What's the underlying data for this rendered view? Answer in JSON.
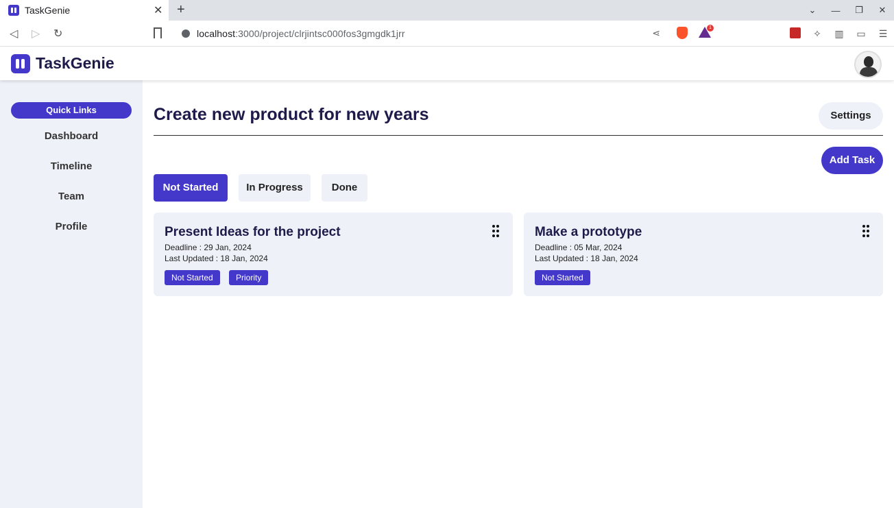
{
  "browser": {
    "tab_title": "TaskGenie",
    "url_host": "localhost",
    "url_rest": ":3000/project/clrjintsc000fos3gmgdk1jrr",
    "bat_badge": "1"
  },
  "app": {
    "logo_text": "TaskGenie",
    "accent": "#4338ca"
  },
  "sidebar": {
    "quick_links": "Quick Links",
    "items": [
      {
        "label": "Dashboard"
      },
      {
        "label": "Timeline"
      },
      {
        "label": "Team"
      },
      {
        "label": "Profile"
      }
    ]
  },
  "main": {
    "project_title": "Create new product for new years",
    "settings_label": "Settings",
    "add_task_label": "Add Task",
    "tabs": [
      {
        "label": "Not Started",
        "active": true
      },
      {
        "label": "In Progress",
        "active": false
      },
      {
        "label": "Done",
        "active": false
      }
    ],
    "tasks": [
      {
        "title": "Present Ideas for the project",
        "deadline": "Deadline : 29 Jan, 2024",
        "updated": "Last Updated : 18 Jan, 2024",
        "tags": [
          "Not Started",
          "Priority"
        ]
      },
      {
        "title": "Make a prototype",
        "deadline": "Deadline : 05 Mar, 2024",
        "updated": "Last Updated : 18 Jan, 2024",
        "tags": [
          "Not Started"
        ]
      }
    ]
  }
}
